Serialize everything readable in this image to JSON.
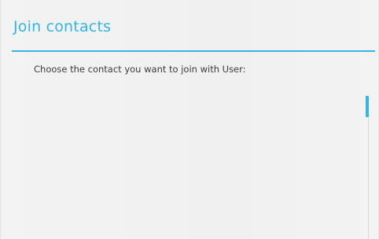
{
  "dialog": {
    "title": "Join contacts",
    "message": "Choose the contact you want to join with User:"
  },
  "colors": {
    "accent": "#33b5e5",
    "background": "#f2f2f2",
    "text": "#3b3b3b"
  },
  "contact_list": {
    "items": []
  }
}
